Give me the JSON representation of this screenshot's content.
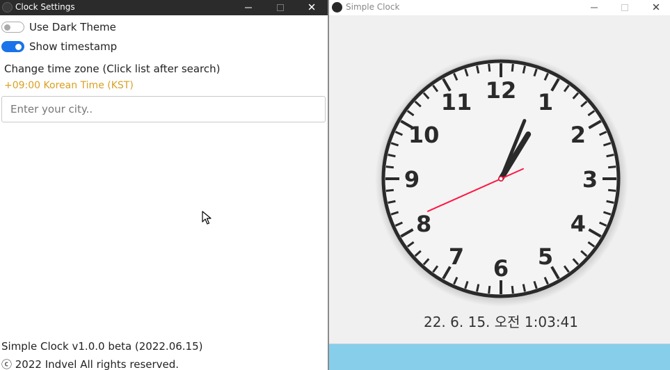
{
  "settings_window": {
    "title": "Clock Settings",
    "dark_theme": {
      "label": "Use Dark Theme",
      "enabled": false
    },
    "show_timestamp": {
      "label": "Show timestamp",
      "enabled": true
    },
    "timezone": {
      "heading": "Change time zone (Click list after search)",
      "current": "+09:00 Korean Time (KST)"
    },
    "city_search": {
      "value": "",
      "placeholder": "Enter your city.."
    },
    "version": "Simple Clock v1.0.0 beta (2022.06.15)",
    "copyright": "ⓒ 2022 Indvel All rights reserved."
  },
  "clock_window": {
    "title": "Simple Clock",
    "numbers": [
      "12",
      "1",
      "2",
      "3",
      "4",
      "5",
      "6",
      "7",
      "8",
      "9",
      "10",
      "11"
    ],
    "time": {
      "hour": 1,
      "minute": 3,
      "second": 41
    },
    "timestamp": "22. 6. 15. 오전 1:03:41"
  },
  "colors": {
    "toggle_on": "#1a73e8",
    "timezone_text": "#d9a024",
    "second_hand": "#ff1744",
    "bottom_bar": "#87ceeb"
  },
  "icons": [
    "minimize-icon",
    "maximize-icon",
    "close-icon",
    "app-icon",
    "mouse-cursor-icon"
  ]
}
